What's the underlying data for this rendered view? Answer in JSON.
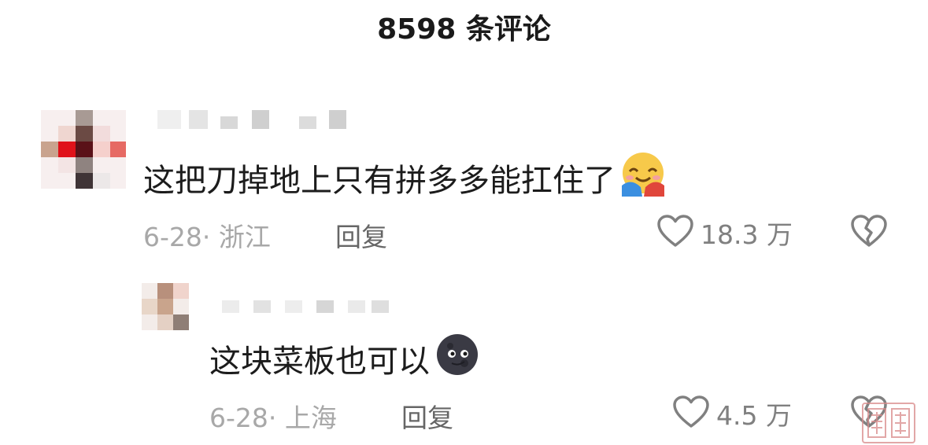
{
  "header": {
    "title": "8598 条评论"
  },
  "comments": [
    {
      "text": "这把刀掉地上只有拼多多能扛住了",
      "emoji": "hugging-face-emoji",
      "date": "6-28",
      "location": "浙江",
      "reply_label": "回复",
      "likes": "18.3 万"
    },
    {
      "text": "这块菜板也可以",
      "emoji": "new-moon-face-emoji",
      "date": "6-28",
      "location": "上海",
      "reply_label": "回复",
      "likes": "4.5 万"
    }
  ],
  "colors": {
    "text": "#1c1c1c",
    "meta": "#a8a8a8",
    "reply": "#666666",
    "icon": "#808080"
  }
}
